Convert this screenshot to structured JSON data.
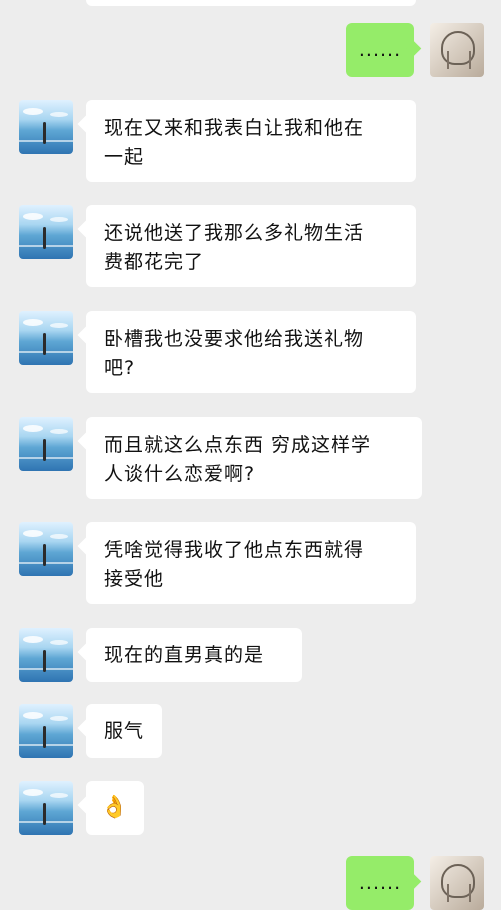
{
  "messages": [
    {
      "text": "......"
    },
    {
      "text": "现在又来和我表白让我和他在\n一起"
    },
    {
      "text": "还说他送了我那么多礼物生活\n费都花完了"
    },
    {
      "text": "卧槽我也没要求他给我送礼物\n吧?"
    },
    {
      "text": "而且就这么点东西 穷成这样学\n人谈什么恋爱啊?"
    },
    {
      "text": "凭啥觉得我收了他点东西就得\n接受他"
    },
    {
      "text": "现在的直男真的是"
    },
    {
      "text": "服气"
    },
    {
      "text": "👌"
    },
    {
      "text": "......"
    }
  ],
  "avatars": {
    "me": "sketch-avatar",
    "friend": "sea-avatar"
  }
}
